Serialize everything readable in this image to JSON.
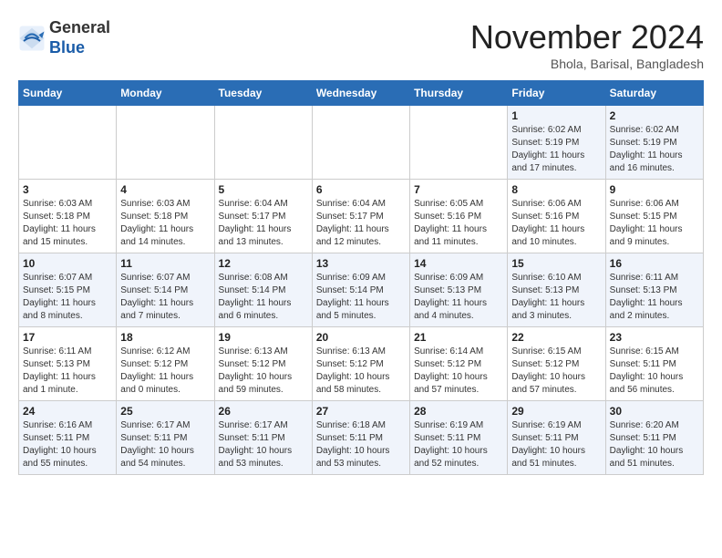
{
  "logo": {
    "general": "General",
    "blue": "Blue"
  },
  "title": "November 2024",
  "location": "Bhola, Barisal, Bangladesh",
  "days_of_week": [
    "Sunday",
    "Monday",
    "Tuesday",
    "Wednesday",
    "Thursday",
    "Friday",
    "Saturday"
  ],
  "weeks": [
    [
      {
        "day": "",
        "info": ""
      },
      {
        "day": "",
        "info": ""
      },
      {
        "day": "",
        "info": ""
      },
      {
        "day": "",
        "info": ""
      },
      {
        "day": "",
        "info": ""
      },
      {
        "day": "1",
        "info": "Sunrise: 6:02 AM\nSunset: 5:19 PM\nDaylight: 11 hours and 17 minutes."
      },
      {
        "day": "2",
        "info": "Sunrise: 6:02 AM\nSunset: 5:19 PM\nDaylight: 11 hours and 16 minutes."
      }
    ],
    [
      {
        "day": "3",
        "info": "Sunrise: 6:03 AM\nSunset: 5:18 PM\nDaylight: 11 hours and 15 minutes."
      },
      {
        "day": "4",
        "info": "Sunrise: 6:03 AM\nSunset: 5:18 PM\nDaylight: 11 hours and 14 minutes."
      },
      {
        "day": "5",
        "info": "Sunrise: 6:04 AM\nSunset: 5:17 PM\nDaylight: 11 hours and 13 minutes."
      },
      {
        "day": "6",
        "info": "Sunrise: 6:04 AM\nSunset: 5:17 PM\nDaylight: 11 hours and 12 minutes."
      },
      {
        "day": "7",
        "info": "Sunrise: 6:05 AM\nSunset: 5:16 PM\nDaylight: 11 hours and 11 minutes."
      },
      {
        "day": "8",
        "info": "Sunrise: 6:06 AM\nSunset: 5:16 PM\nDaylight: 11 hours and 10 minutes."
      },
      {
        "day": "9",
        "info": "Sunrise: 6:06 AM\nSunset: 5:15 PM\nDaylight: 11 hours and 9 minutes."
      }
    ],
    [
      {
        "day": "10",
        "info": "Sunrise: 6:07 AM\nSunset: 5:15 PM\nDaylight: 11 hours and 8 minutes."
      },
      {
        "day": "11",
        "info": "Sunrise: 6:07 AM\nSunset: 5:14 PM\nDaylight: 11 hours and 7 minutes."
      },
      {
        "day": "12",
        "info": "Sunrise: 6:08 AM\nSunset: 5:14 PM\nDaylight: 11 hours and 6 minutes."
      },
      {
        "day": "13",
        "info": "Sunrise: 6:09 AM\nSunset: 5:14 PM\nDaylight: 11 hours and 5 minutes."
      },
      {
        "day": "14",
        "info": "Sunrise: 6:09 AM\nSunset: 5:13 PM\nDaylight: 11 hours and 4 minutes."
      },
      {
        "day": "15",
        "info": "Sunrise: 6:10 AM\nSunset: 5:13 PM\nDaylight: 11 hours and 3 minutes."
      },
      {
        "day": "16",
        "info": "Sunrise: 6:11 AM\nSunset: 5:13 PM\nDaylight: 11 hours and 2 minutes."
      }
    ],
    [
      {
        "day": "17",
        "info": "Sunrise: 6:11 AM\nSunset: 5:13 PM\nDaylight: 11 hours and 1 minute."
      },
      {
        "day": "18",
        "info": "Sunrise: 6:12 AM\nSunset: 5:12 PM\nDaylight: 11 hours and 0 minutes."
      },
      {
        "day": "19",
        "info": "Sunrise: 6:13 AM\nSunset: 5:12 PM\nDaylight: 10 hours and 59 minutes."
      },
      {
        "day": "20",
        "info": "Sunrise: 6:13 AM\nSunset: 5:12 PM\nDaylight: 10 hours and 58 minutes."
      },
      {
        "day": "21",
        "info": "Sunrise: 6:14 AM\nSunset: 5:12 PM\nDaylight: 10 hours and 57 minutes."
      },
      {
        "day": "22",
        "info": "Sunrise: 6:15 AM\nSunset: 5:12 PM\nDaylight: 10 hours and 57 minutes."
      },
      {
        "day": "23",
        "info": "Sunrise: 6:15 AM\nSunset: 5:11 PM\nDaylight: 10 hours and 56 minutes."
      }
    ],
    [
      {
        "day": "24",
        "info": "Sunrise: 6:16 AM\nSunset: 5:11 PM\nDaylight: 10 hours and 55 minutes."
      },
      {
        "day": "25",
        "info": "Sunrise: 6:17 AM\nSunset: 5:11 PM\nDaylight: 10 hours and 54 minutes."
      },
      {
        "day": "26",
        "info": "Sunrise: 6:17 AM\nSunset: 5:11 PM\nDaylight: 10 hours and 53 minutes."
      },
      {
        "day": "27",
        "info": "Sunrise: 6:18 AM\nSunset: 5:11 PM\nDaylight: 10 hours and 53 minutes."
      },
      {
        "day": "28",
        "info": "Sunrise: 6:19 AM\nSunset: 5:11 PM\nDaylight: 10 hours and 52 minutes."
      },
      {
        "day": "29",
        "info": "Sunrise: 6:19 AM\nSunset: 5:11 PM\nDaylight: 10 hours and 51 minutes."
      },
      {
        "day": "30",
        "info": "Sunrise: 6:20 AM\nSunset: 5:11 PM\nDaylight: 10 hours and 51 minutes."
      }
    ]
  ]
}
